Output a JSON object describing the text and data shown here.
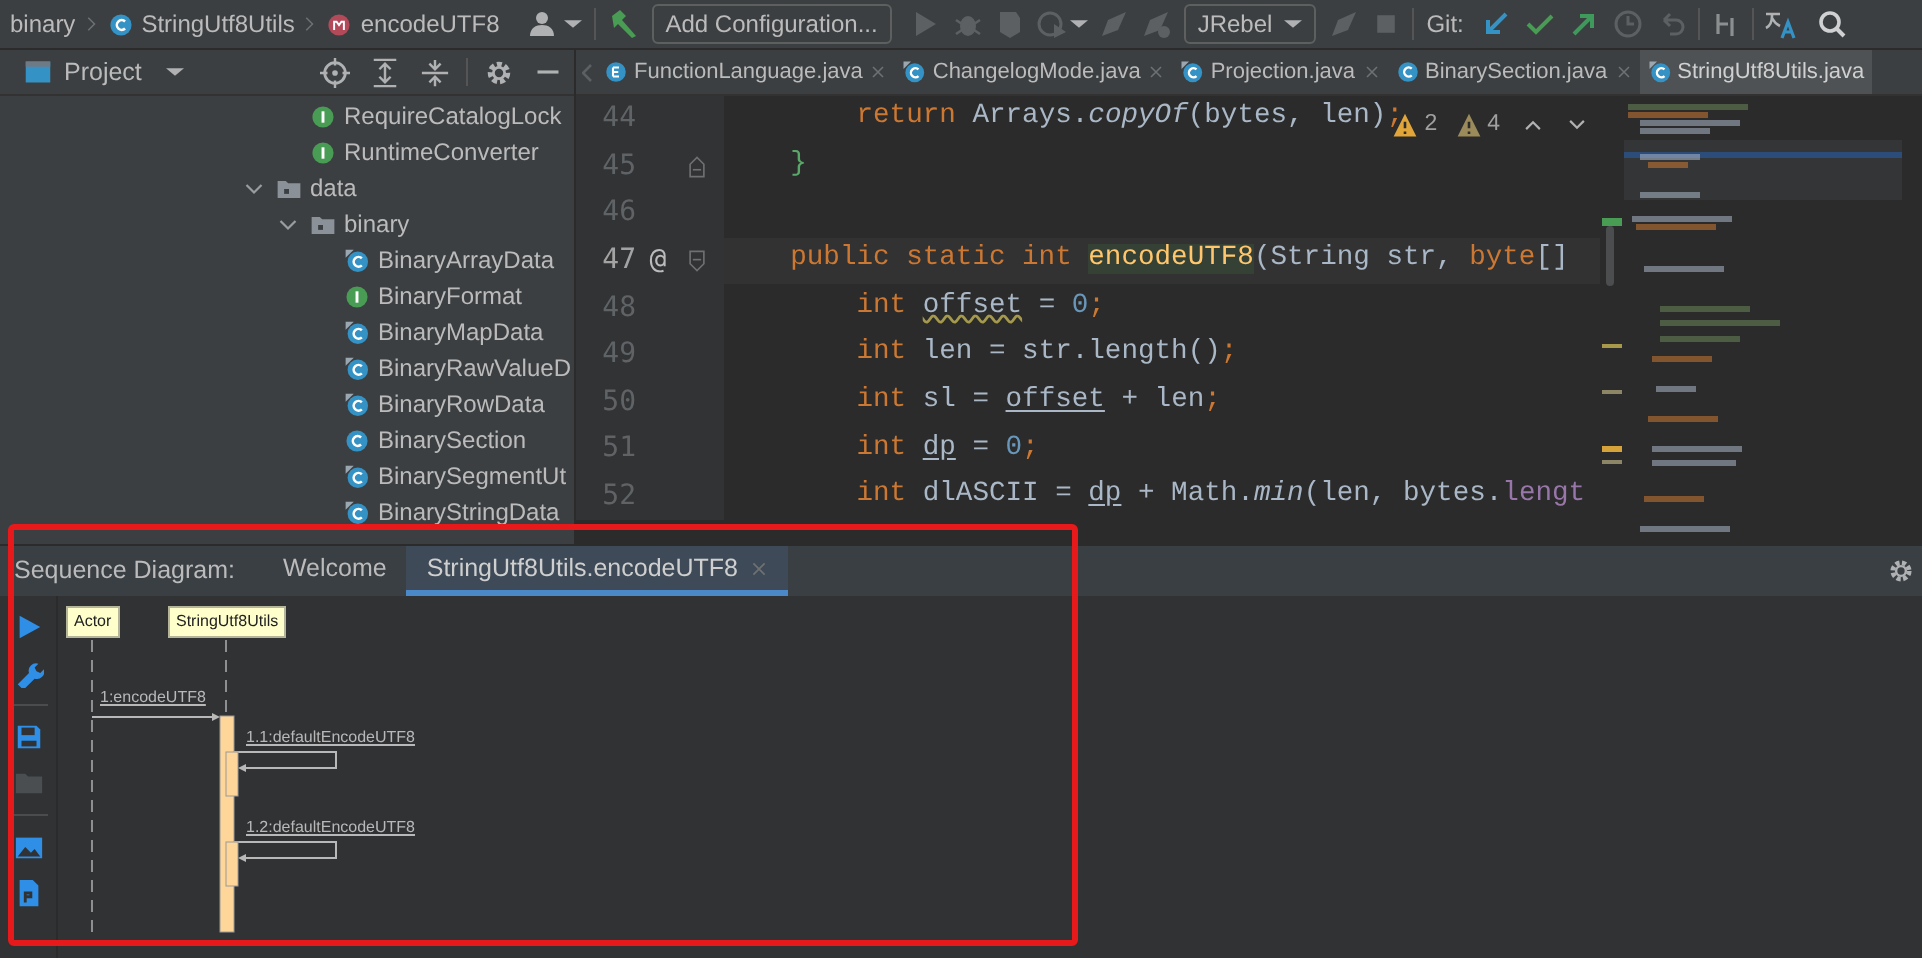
{
  "breadcrumbs": [
    {
      "label": "binary",
      "kind": "package"
    },
    {
      "label": "StringUtf8Utils",
      "kind": "class"
    },
    {
      "label": "encodeUTF8",
      "kind": "method"
    }
  ],
  "toolbar": {
    "config_button": "Add Configuration...",
    "plugin_dropdown": "JRebel",
    "vcs_label": "Git:"
  },
  "project_panel": {
    "title": "Project",
    "tree": {
      "continued_items": [
        {
          "label": "RequireCatalogLock",
          "kind": "interface"
        },
        {
          "label": "RuntimeConverter",
          "kind": "interface"
        }
      ],
      "items": [
        {
          "label": "data",
          "kind": "folder",
          "expanded": true,
          "children": [
            {
              "label": "binary",
              "kind": "folder",
              "expanded": true,
              "children": [
                {
                  "label": "BinaryArrayData",
                  "kind": "class-abstract"
                },
                {
                  "label": "BinaryFormat",
                  "kind": "interface"
                },
                {
                  "label": "BinaryMapData",
                  "kind": "class-abstract"
                },
                {
                  "label": "BinaryRawValueD",
                  "kind": "class-abstract"
                },
                {
                  "label": "BinaryRowData",
                  "kind": "class-abstract"
                },
                {
                  "label": "BinarySection",
                  "kind": "class"
                },
                {
                  "label": "BinarySegmentUt",
                  "kind": "class-abstract"
                },
                {
                  "label": "BinaryStringData",
                  "kind": "class-abstract"
                }
              ]
            }
          ]
        }
      ]
    }
  },
  "editor": {
    "tabs": [
      {
        "label": "FunctionLanguage.java",
        "kind": "enum",
        "selected": false,
        "close_button": true
      },
      {
        "label": "ChangelogMode.java",
        "kind": "class-abstract",
        "selected": false,
        "close_button": true
      },
      {
        "label": "Projection.java",
        "kind": "class-abstract",
        "selected": false,
        "close_button": true
      },
      {
        "label": "BinarySection.java",
        "kind": "class",
        "selected": false,
        "close_button": true
      },
      {
        "label": "StringUtf8Utils.java",
        "kind": "class-abstract",
        "selected": true,
        "close_button": false
      }
    ],
    "inspections": [
      {
        "kind": "warning",
        "count": "2"
      },
      {
        "kind": "weak",
        "count": "4"
      }
    ],
    "lines": [
      {
        "number": "44",
        "kind": "code",
        "current": false,
        "tokens": [
          {
            "text": "        return",
            "kind": "keyword"
          },
          {
            "text": " Arrays.",
            "kind": "plain"
          },
          {
            "text": "copyOf",
            "kind": "static"
          },
          {
            "text": "(bytes, len)",
            "kind": "plain"
          },
          {
            "text": ";",
            "kind": "semicolon"
          }
        ]
      },
      {
        "number": "45",
        "kind": "closing",
        "current": false,
        "tokens": [
          {
            "text": "    }",
            "kind": "brace"
          }
        ]
      },
      {
        "number": "46",
        "kind": "code",
        "current": false
      },
      {
        "number": "47",
        "kind": "opening",
        "current": true,
        "marker": "@",
        "tokens": [
          {
            "text": "    public static int ",
            "kind": "keyword"
          },
          {
            "text": "encodeUTF8",
            "kind": "declaration"
          },
          {
            "text": "(String str, ",
            "kind": "plain"
          },
          {
            "text": "byte",
            "kind": "keyword"
          },
          {
            "text": "[] ",
            "kind": "plain"
          }
        ]
      },
      {
        "number": "48",
        "kind": "code",
        "current": false,
        "tokens": [
          {
            "text": "        int ",
            "kind": "keyword"
          },
          {
            "text": "offset",
            "kind": "warning"
          },
          {
            "text": " = ",
            "kind": "plain"
          },
          {
            "text": "0",
            "kind": "number"
          },
          {
            "text": ";",
            "kind": "semicolon"
          }
        ]
      },
      {
        "number": "49",
        "kind": "code",
        "current": false,
        "tokens": [
          {
            "text": "        int ",
            "kind": "keyword"
          },
          {
            "text": "len = str.length()",
            "kind": "plain"
          },
          {
            "text": ";",
            "kind": "semicolon"
          }
        ]
      },
      {
        "number": "50",
        "kind": "code",
        "current": false,
        "tokens": [
          {
            "text": "        int ",
            "kind": "keyword"
          },
          {
            "text": "sl = ",
            "kind": "plain"
          },
          {
            "text": "offset",
            "kind": "reassigned"
          },
          {
            "text": " + len",
            "kind": "plain"
          },
          {
            "text": ";",
            "kind": "semicolon"
          }
        ]
      },
      {
        "number": "51",
        "kind": "code",
        "current": false,
        "tokens": [
          {
            "text": "        int ",
            "kind": "keyword"
          },
          {
            "text": "dp",
            "kind": "reassigned"
          },
          {
            "text": " = ",
            "kind": "plain"
          },
          {
            "text": "0",
            "kind": "number"
          },
          {
            "text": ";",
            "kind": "semicolon"
          }
        ]
      },
      {
        "number": "52",
        "kind": "code",
        "current": false,
        "tokens": [
          {
            "text": "        int ",
            "kind": "keyword"
          },
          {
            "text": "dlASCII = ",
            "kind": "plain"
          },
          {
            "text": "dp",
            "kind": "reassigned"
          },
          {
            "text": " + Math.",
            "kind": "plain"
          },
          {
            "text": "min",
            "kind": "static"
          },
          {
            "text": "(len, bytes.",
            "kind": "plain"
          },
          {
            "text": "lengt",
            "kind": "field"
          }
        ]
      }
    ]
  },
  "sequence_panel": {
    "title": "Sequence Diagram:",
    "tabs": [
      {
        "label": "Welcome",
        "selected": false,
        "close_button": false
      },
      {
        "label": "StringUtf8Utils.encodeUTF8",
        "selected": true,
        "close_button": true
      }
    ],
    "tools": [
      {
        "kind": "run",
        "disabled": false
      },
      {
        "kind": "settings",
        "disabled": false
      },
      {
        "kind": "save",
        "disabled": false
      },
      {
        "kind": "open",
        "disabled": true
      },
      {
        "kind": "image",
        "disabled": false
      },
      {
        "kind": "export",
        "disabled": false
      }
    ],
    "participants": [
      {
        "name": "Actor"
      },
      {
        "name": "StringUtf8Utils"
      }
    ],
    "messages": [
      {
        "label": "1:encodeUTF8",
        "kind": "call"
      },
      {
        "label": "1.1:defaultEncodeUTF8",
        "kind": "self"
      },
      {
        "label": "1.2:defaultEncodeUTF8",
        "kind": "self"
      }
    ]
  }
}
